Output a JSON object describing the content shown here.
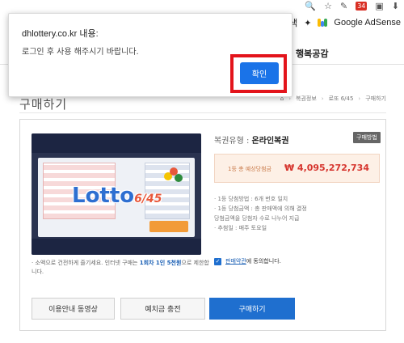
{
  "browser": {
    "notification_count": "34",
    "bookmarks": [
      "색",
      "Google AdSense"
    ]
  },
  "site_nav": {
    "items": [
      "행복공감"
    ]
  },
  "page": {
    "title": "구매하기",
    "breadcrumb": [
      "복권정보",
      "로또 6/45",
      "구매하기"
    ]
  },
  "product": {
    "image_logo_main": "Lotto",
    "image_logo_suffix": "6/45",
    "ticket_type_label": "복권유형 :",
    "ticket_type_value": "온라인복권",
    "buy_method_badge": "구매방법",
    "prize_label": "1등 총 예상당첨금",
    "prize_amount": "₩ 4,095,272,734",
    "info": [
      "· 1등 당첨방법 : 6개 번호 일치",
      "· 1등 당첨금액 : 총 판매액에 의해 결정",
      "  당첨금액을 당첨자 수로 나누어 지급",
      "· 추첨일 : 매주 토요일"
    ],
    "disclaimer_pre": "· 소액으로 건전하게 즐기세요. 인터넷 구매는 ",
    "disclaimer_highlight": "1회차 1인 5천원",
    "disclaimer_post": "으로 제한합니다.",
    "consent_link": "판매약관",
    "consent_text": "에 동의합니다."
  },
  "buttons": {
    "video": "이용안내 동영상",
    "deposit": "예치금 충전",
    "buy": "구매하기"
  },
  "dialog": {
    "title": "dhlottery.co.kr 내용:",
    "message": "로그인 후 사용 해주시기 바랍니다.",
    "confirm": "확인"
  },
  "colors": {
    "accent_blue": "#1f6fcf",
    "dialog_button": "#1a73e8",
    "highlight_red": "#e3141b",
    "prize_red": "#d6352e"
  }
}
